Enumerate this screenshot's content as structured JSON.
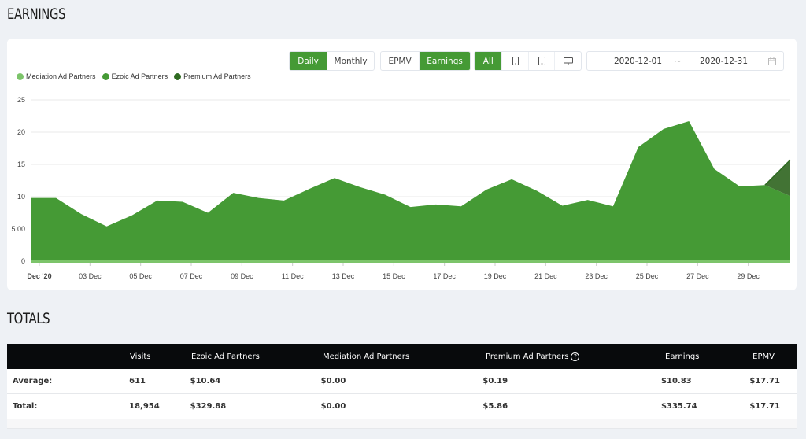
{
  "page": {
    "earnings_title": "EARNINGS",
    "totals_title": "TOTALS"
  },
  "controls": {
    "period": [
      {
        "label": "Daily",
        "active": true
      },
      {
        "label": "Monthly",
        "active": false
      }
    ],
    "metric": [
      {
        "label": "EPMV",
        "active": false
      },
      {
        "label": "Earnings",
        "active": true
      }
    ],
    "device": [
      {
        "label": "All",
        "icon": "",
        "active": true
      },
      {
        "label": "",
        "icon": "mobile-icon",
        "active": false
      },
      {
        "label": "",
        "icon": "tablet-icon",
        "active": false
      },
      {
        "label": "",
        "icon": "desktop-icon",
        "active": false
      }
    ],
    "date_start": "2020-12-01",
    "date_sep": "~",
    "date_end": "2020-12-31",
    "calendar_icon": "calendar-icon"
  },
  "colors": {
    "mediation": "#7cc46a",
    "ezoic": "#459a35",
    "premium": "#2f6b22",
    "premium_fill": "#427334",
    "accent": "#459a35",
    "table_header": "#080a0c"
  },
  "chart_data": {
    "type": "area",
    "stacked": true,
    "title": "",
    "xlabel": "",
    "ylabel": "",
    "ylim": [
      0,
      25
    ],
    "y_ticks": [
      0,
      5,
      10,
      15,
      20,
      25
    ],
    "y_tick_labels": [
      "0",
      "5.00",
      "10",
      "15",
      "20",
      "25"
    ],
    "x_tick_labels": [
      "Dec '20",
      "03 Dec",
      "05 Dec",
      "07 Dec",
      "09 Dec",
      "11 Dec",
      "13 Dec",
      "15 Dec",
      "17 Dec",
      "19 Dec",
      "21 Dec",
      "23 Dec",
      "25 Dec",
      "27 Dec",
      "29 Dec"
    ],
    "x_tick_days": [
      1,
      3,
      5,
      7,
      9,
      11,
      13,
      15,
      17,
      19,
      21,
      23,
      25,
      27,
      29
    ],
    "grid": true,
    "legend_position": "top-left",
    "legend": [
      "Mediation Ad Partners",
      "Ezoic Ad Partners",
      "Premium Ad Partners"
    ],
    "days": [
      1,
      2,
      3,
      4,
      5,
      6,
      7,
      8,
      9,
      10,
      11,
      12,
      13,
      14,
      15,
      16,
      17,
      18,
      19,
      20,
      21,
      22,
      23,
      24,
      25,
      26,
      27,
      28,
      29,
      30,
      31
    ],
    "series": [
      {
        "name": "Mediation Ad Partners",
        "values": [
          0,
          0,
          0,
          0,
          0,
          0,
          0,
          0,
          0,
          0,
          0,
          0,
          0,
          0,
          0,
          0,
          0,
          0,
          0,
          0,
          0,
          0,
          0,
          0,
          0,
          0,
          0,
          0,
          0,
          0,
          0
        ]
      },
      {
        "name": "Ezoic Ad Partners",
        "values": [
          9.8,
          9.8,
          7.3,
          5.4,
          7.1,
          9.4,
          9.2,
          7.5,
          10.6,
          9.8,
          9.4,
          11.2,
          12.9,
          11.5,
          10.3,
          8.4,
          8.8,
          8.5,
          11.1,
          12.7,
          10.9,
          8.6,
          9.5,
          8.5,
          17.7,
          20.5,
          21.7,
          14.3,
          11.6,
          11.8,
          10.1
        ]
      },
      {
        "name": "Premium Ad Partners",
        "values": [
          0,
          0,
          0,
          0,
          0,
          0,
          0,
          0,
          0,
          0,
          0,
          0,
          0,
          0,
          0,
          0,
          0,
          0,
          0,
          0,
          0,
          0,
          0,
          0,
          0,
          0,
          0,
          0,
          0,
          0,
          5.6
        ]
      }
    ]
  },
  "table": {
    "headers": [
      "",
      "Visits",
      "Ezoic Ad Partners",
      "Mediation Ad Partners",
      "Premium Ad Partners",
      "Earnings",
      "EPMV"
    ],
    "rows": [
      [
        "Average:",
        "611",
        "$10.64",
        "$0.00",
        "$0.19",
        "$10.83",
        "$17.71"
      ],
      [
        "Total:",
        "18,954",
        "$329.88",
        "$0.00",
        "$5.86",
        "$335.74",
        "$17.71"
      ]
    ],
    "help_icon": "?"
  }
}
